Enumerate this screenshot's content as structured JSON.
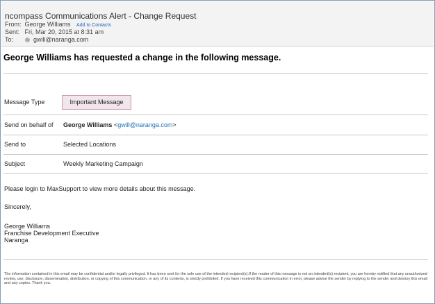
{
  "email": {
    "title": "ncompass Communications Alert - Change Request",
    "from_label": "From:",
    "from_value": "George Williams",
    "add_contacts": "Add to Contacts",
    "sent_label": "Sent:",
    "sent_value": "Fri, Mar 20, 2015 at 8:31 am",
    "to_label": "To:",
    "to_value": "gwill@naranga.com"
  },
  "content": {
    "headline": "George Williams has requested a change in the following message.",
    "rows": [
      {
        "label": "Message Type",
        "value": "Important Message"
      },
      {
        "label": "Send on behalf of",
        "name": "George Williams",
        "lt": "<",
        "email": "gwill@naranga.com",
        "gt": ">"
      },
      {
        "label": "Send to",
        "value": "Selected Locations"
      },
      {
        "label": "Subject",
        "value": "Weekly Marketing Campaign"
      }
    ],
    "login_text": "Please login to MaxSupport to view more details about this message.",
    "sincerely": "Sincerely,",
    "signature_name": "George Williams",
    "signature_title": "Franchise Development Executive",
    "signature_company": "Naranga",
    "disclaimer": "The information contained in this email may be confidential and/or legally privileged. It has been sent for the sole use of the intended recipient(s).If the reader of this message is not an intended(s) recipient, you are hereby notified that any unauthorized review, use, disclosure, dissemination, distribution, or copying of this communication, or any of its contents, is strictly prohibited. If you have received this communication in error, please advise the sender by replying to the sender and destroy this email and any copies. Thank you."
  }
}
